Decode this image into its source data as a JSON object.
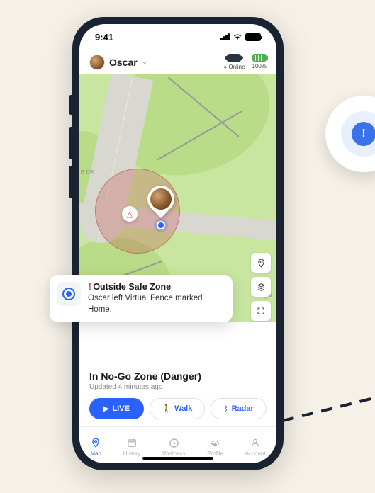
{
  "statusBar": {
    "time": "9:41"
  },
  "header": {
    "petName": "Oscar",
    "deviceStatus": "Online",
    "batteryPercent": "100%"
  },
  "map": {
    "streetLabel1": "E DR",
    "streetLabel2": "Legal"
  },
  "notification": {
    "emoji": "!!",
    "title": "Outside Safe Zone",
    "body": "Oscar left Virtual Fence marked Home."
  },
  "panel": {
    "zoneStatus": "In No-Go Zone (Danger)",
    "updated": "Updated 4 minutes ago"
  },
  "actions": {
    "live": "LIVE",
    "walk": "Walk",
    "radar": "Radar"
  },
  "tabs": {
    "map": "Map",
    "history": "History",
    "wellness": "Wellness",
    "profile": "Profile",
    "account": "Account"
  }
}
